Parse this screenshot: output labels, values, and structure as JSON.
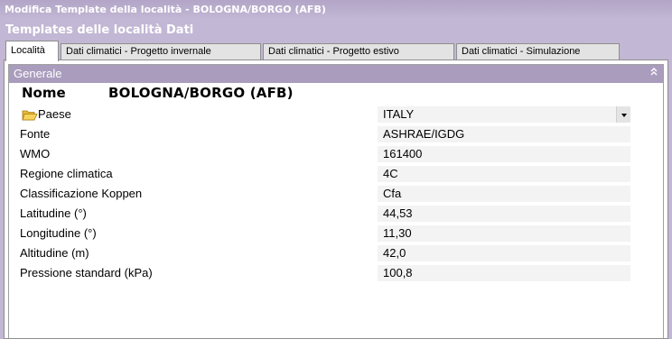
{
  "window": {
    "title": "Modifica Template della località - BOLOGNA/BORGO (AFB)",
    "heading": "Templates delle località Dati"
  },
  "tabs": [
    {
      "label": "Località",
      "active": true
    },
    {
      "label": "Dati climatici - Progetto invernale",
      "active": false
    },
    {
      "label": "Dati climatici - Progetto estivo",
      "active": false
    },
    {
      "label": "Dati climatici - Simulazione",
      "active": false
    }
  ],
  "group": {
    "title": "Generale",
    "collapse_icon": "double-chevron-up-icon"
  },
  "name_row": {
    "label": "Nome",
    "value": "BOLOGNA/BORGO (AFB)"
  },
  "properties": [
    {
      "label": "Paese",
      "value": "ITALY",
      "icon": "folder-icon",
      "dropdown": true
    },
    {
      "label": "Fonte",
      "value": "ASHRAE/IGDG"
    },
    {
      "label": "WMO",
      "value": "161400"
    },
    {
      "label": "Regione climatica",
      "value": "4C"
    },
    {
      "label": "Classificazione Koppen",
      "value": "Cfa"
    },
    {
      "label": "Latitudine (°)",
      "value": "44,53"
    },
    {
      "label": "Longitudine (°)",
      "value": "11,30"
    },
    {
      "label": "Altitudine (m)",
      "value": "42,0"
    },
    {
      "label": "Pressione standard (kPa)",
      "value": "100,8"
    }
  ],
  "colors": {
    "titlebar": "#b2a5c7",
    "window_bg": "#c2b7d4",
    "group_header": "#a99cbd",
    "value_bg": "#f3f3f3"
  }
}
